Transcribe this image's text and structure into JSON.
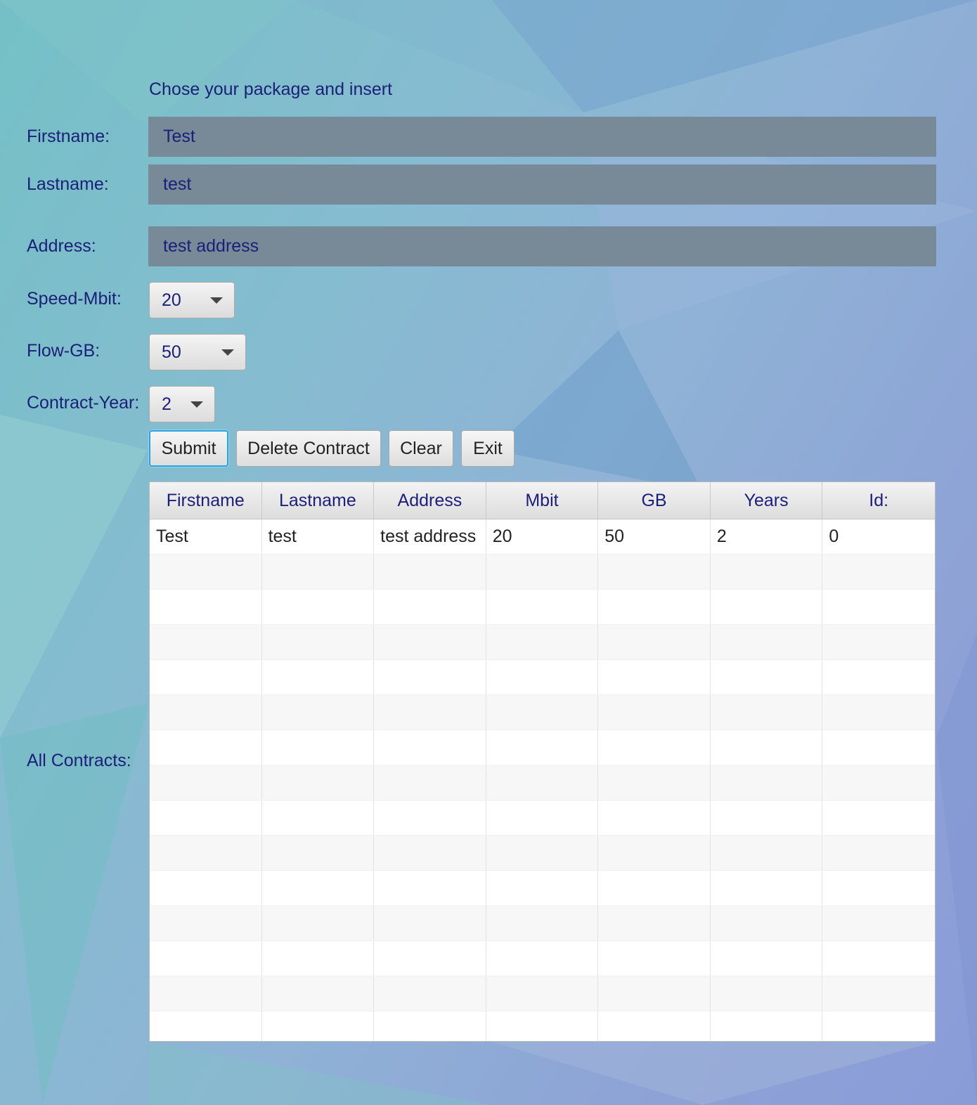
{
  "heading": "Chose your package and insert",
  "form": {
    "firstname_label": "Firstname:",
    "firstname_value": "Test",
    "lastname_label": "Lastname:",
    "lastname_value": "test",
    "address_label": "Address:",
    "address_value": "test address",
    "speed_label": "Speed-Mbit:",
    "speed_value": "20",
    "flow_label": "Flow-GB:",
    "flow_value": "50",
    "contract_label": "Contract-Year:",
    "contract_value": "2"
  },
  "buttons": {
    "submit": "Submit",
    "delete": "Delete Contract",
    "clear": "Clear",
    "exit": "Exit"
  },
  "contracts": {
    "label": "All Contracts:",
    "columns": [
      "Firstname",
      "Lastname",
      "Address",
      "Mbit",
      "GB",
      "Years",
      "Id:"
    ],
    "rows": [
      [
        "Test",
        "test",
        "test address",
        "20",
        "50",
        "2",
        "0"
      ]
    ],
    "empty_rows": 14
  }
}
